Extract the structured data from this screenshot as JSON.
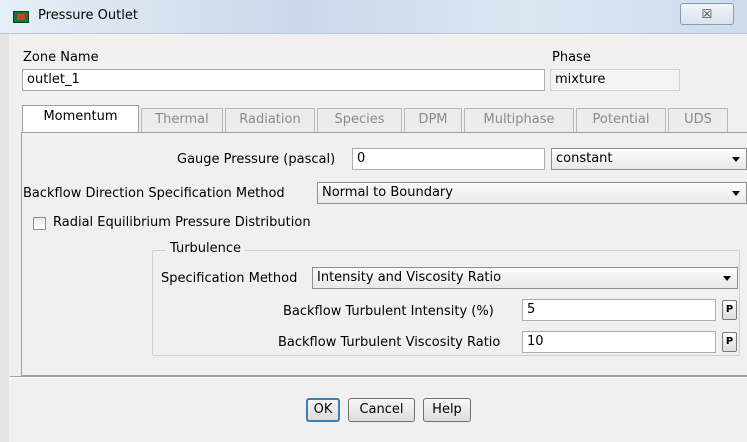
{
  "window": {
    "title": "Pressure Outlet",
    "close_glyph": "☒"
  },
  "zone": {
    "label": "Zone Name",
    "value": "outlet_1"
  },
  "phase": {
    "label": "Phase",
    "value": "mixture"
  },
  "tabs": [
    {
      "label": "Momentum",
      "active": true
    },
    {
      "label": "Thermal",
      "active": false
    },
    {
      "label": "Radiation",
      "active": false
    },
    {
      "label": "Species",
      "active": false
    },
    {
      "label": "DPM",
      "active": false
    },
    {
      "label": "Multiphase",
      "active": false
    },
    {
      "label": "Potential",
      "active": false
    },
    {
      "label": "UDS",
      "active": false
    }
  ],
  "momentum": {
    "gauge_pressure_label": "Gauge Pressure (pascal)",
    "gauge_pressure_value": "0",
    "gauge_pressure_method": "constant",
    "backflow_direction_label": "Backflow Direction Specification Method",
    "backflow_direction_value": "Normal to Boundary",
    "radial_eq_label": "Radial Equilibrium Pressure Distribution",
    "radial_eq_checked": false
  },
  "turbulence": {
    "title": "Turbulence",
    "spec_method_label": "Specification Method",
    "spec_method_value": "Intensity and Viscosity Ratio",
    "intensity_label": "Backflow Turbulent Intensity (%)",
    "intensity_value": "5",
    "viscosity_label": "Backflow Turbulent Viscosity Ratio",
    "viscosity_value": "10",
    "p_button_label": "P"
  },
  "buttons": {
    "ok": "OK",
    "cancel": "Cancel",
    "help": "Help"
  }
}
